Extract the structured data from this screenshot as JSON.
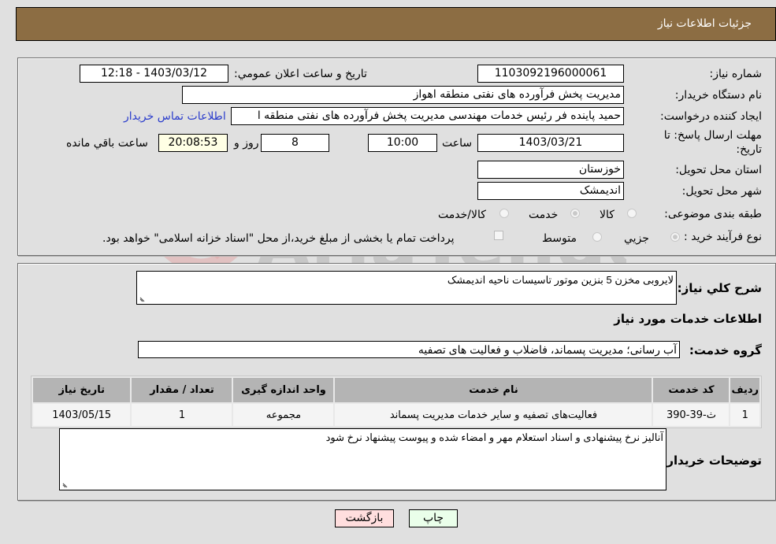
{
  "header": {
    "title": "جزئيات اطلاعات نیاز"
  },
  "form": {
    "need_number": {
      "label": "شماره نیاز:",
      "value": "1103092196000061"
    },
    "announce_datetime": {
      "label": "تاريخ و ساعت اعلان عمومي:",
      "value": "1403/03/12 - 12:18"
    },
    "buyer_org": {
      "label": "نام دستگاه خریدار:",
      "value": "مدیریت پخش فرآورده های نفتی منطقه اهواز"
    },
    "requester": {
      "label": "ایجاد کننده درخواست:",
      "value": "حمید پاینده فر رئیس خدمات مهندسی مدیریت پخش فرآورده های نفتی منطقه ا",
      "contact_link": "اطلاعات تماس خریدار"
    },
    "deadline": {
      "label_line1": "مهلت ارسال پاسخ: تا",
      "label_line2": "تاریخ:",
      "date": "1403/03/21",
      "time_label": "ساعت",
      "time": "10:00",
      "days": "8",
      "days_label": "روز و",
      "remaining": "20:08:53",
      "remaining_label": "ساعت باقي مانده"
    },
    "province": {
      "label": "استان محل تحویل:",
      "value": "خوزستان"
    },
    "city": {
      "label": "شهر محل تحویل:",
      "value": "اندیمشک"
    },
    "category": {
      "label": "طبقه بندی موضوعی:",
      "options": [
        {
          "label": "کالا",
          "checked": false
        },
        {
          "label": "خدمت",
          "checked": true
        },
        {
          "label": "کالا/خدمت",
          "checked": false
        }
      ]
    },
    "process": {
      "label": "نوع فرآیند خرید :",
      "options": [
        {
          "label": "جزيي",
          "checked": true
        },
        {
          "label": "متوسط",
          "checked": false
        }
      ],
      "treasury_checkbox_label": "پرداخت تمام یا بخشی از مبلغ خرید،از محل \"اسناد خزانه اسلامی\" خواهد بود."
    }
  },
  "details": {
    "description_label": "شرح كلي نياز:",
    "description": "لایروبی مخزن 5 بنزین موتور تاسیسات  ناحیه اندیمشک",
    "services_heading": "اطلاعات خدمات مورد نیاز",
    "service_group_label": "گروه خدمت:",
    "service_group": "آب رسانی؛ مدیریت پسماند، فاضلاب و فعالیت های تصفیه",
    "table": {
      "headers": [
        "رديف",
        "کد خدمت",
        "نام خدمت",
        "واحد اندازه گیری",
        "تعداد / مقدار",
        "تاریخ نیاز"
      ],
      "rows": [
        [
          "1",
          "ث-39-390",
          "فعالیت‌های تصفیه و سایر خدمات مدیریت پسماند",
          "مجموعه",
          "1",
          "1403/05/15"
        ]
      ]
    },
    "buyer_notes_label": "توضیحات خریدار:",
    "buyer_notes": "آنالیز نرخ پیشنهادی و اسناد استعلام مهر و امضاء شده و پیوست پیشنهاد نرخ شود"
  },
  "buttons": {
    "print": "چاپ",
    "back": "بازگشت"
  },
  "colors": {
    "header_bg": "#8c6d43",
    "print_bg": "#eaffea",
    "back_bg": "#ffdede",
    "link": "#2a3ccc"
  }
}
